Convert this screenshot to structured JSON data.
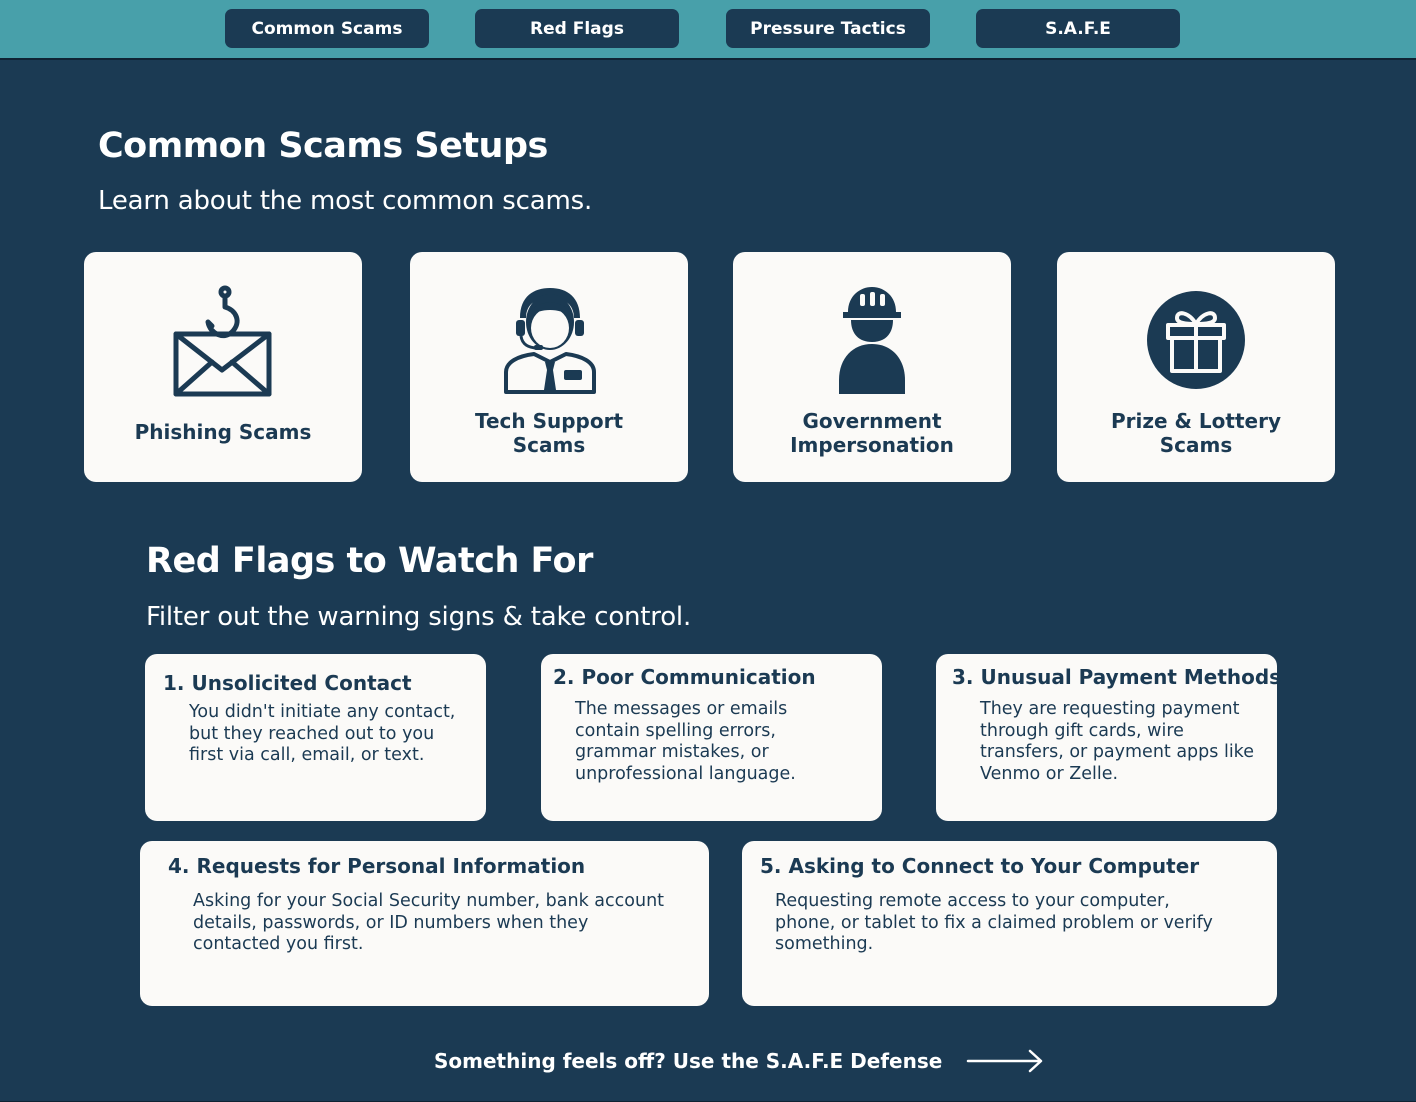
{
  "nav": {
    "items": [
      {
        "label": "Common Scams"
      },
      {
        "label": "Red Flags"
      },
      {
        "label": "Pressure Tactics"
      },
      {
        "label": "S.A.F.E"
      }
    ]
  },
  "scams_section": {
    "title": "Common Scams Setups",
    "subtitle": "Learn about the most common scams.",
    "cards": [
      {
        "label": "Phishing Scams",
        "icon": "email-fishhook-icon"
      },
      {
        "label": "Tech Support\nScams",
        "icon": "headset-agent-icon"
      },
      {
        "label": "Government\nImpersonation",
        "icon": "hardhat-person-icon"
      },
      {
        "label": "Prize & Lottery\nScams",
        "icon": "gift-icon"
      }
    ]
  },
  "flags_section": {
    "title": "Red Flags to Watch For",
    "subtitle": "Filter out the warning signs & take control.",
    "flags": [
      {
        "title": "1.  Unsolicited Contact",
        "body": "You didn't initiate any contact, but they reached out to you first via call, email, or text."
      },
      {
        "title": "2.  Poor Communication",
        "body": "The messages or emails contain spelling errors, grammar mistakes, or unprofessional language."
      },
      {
        "title": "3.  Unusual Payment Methods",
        "body": "They are requesting payment through gift cards, wire transfers, or payment apps like Venmo or Zelle."
      },
      {
        "title": "4.  Requests for Personal Information",
        "body": "Asking for your Social Security number, bank account details, passwords, or ID numbers when they contacted you first."
      },
      {
        "title": "5.  Asking to Connect to Your Computer",
        "body": "Requesting remote access to your computer, phone, or tablet to fix a claimed problem or verify something."
      }
    ]
  },
  "cta": {
    "label": "Something feels off? Use the S.A.F.E Defense",
    "icon": "arrow-right-icon"
  },
  "colors": {
    "background": "#1b3a53",
    "topbar": "#48a0aa",
    "card": "#fbfaf8"
  }
}
